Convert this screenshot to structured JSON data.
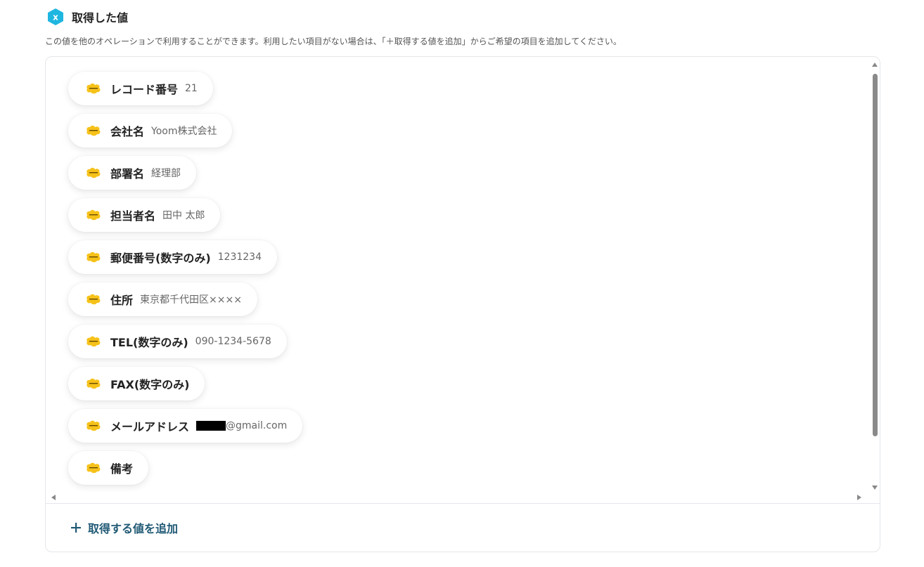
{
  "header": {
    "icon": "variable-x-icon",
    "title": "取得した値",
    "description": "この値を他のオペレーションで利用することができます。利用したい項目がない場合は、「＋取得する値を追加」からご希望の項目を追加してください。"
  },
  "colors": {
    "header_icon": "#1fb6e0",
    "chip_icon": "#f6c21a",
    "add_link": "#215a75"
  },
  "fields": [
    {
      "label": "レコード番号",
      "value": "21",
      "icon": "kintone-icon"
    },
    {
      "label": "会社名",
      "value": "Yoom株式会社",
      "icon": "kintone-icon"
    },
    {
      "label": "部署名",
      "value": "経理部",
      "icon": "kintone-icon"
    },
    {
      "label": "担当者名",
      "value": "田中 太郎",
      "icon": "kintone-icon"
    },
    {
      "label": "郵便番号(数字のみ)",
      "value": "1231234",
      "icon": "kintone-icon"
    },
    {
      "label": "住所",
      "value": "東京都千代田区××××",
      "icon": "kintone-icon"
    },
    {
      "label": "TEL(数字のみ)",
      "value": "090-1234-5678",
      "icon": "kintone-icon"
    },
    {
      "label": "FAX(数字のみ)",
      "value": "",
      "icon": "kintone-icon"
    },
    {
      "label": "メールアドレス",
      "value": "@gmail.com",
      "icon": "kintone-icon",
      "redacted_prefix": true
    },
    {
      "label": "備考",
      "value": "",
      "icon": "kintone-icon"
    }
  ],
  "add_button": {
    "icon": "plus-icon",
    "label": "取得する値を追加"
  }
}
